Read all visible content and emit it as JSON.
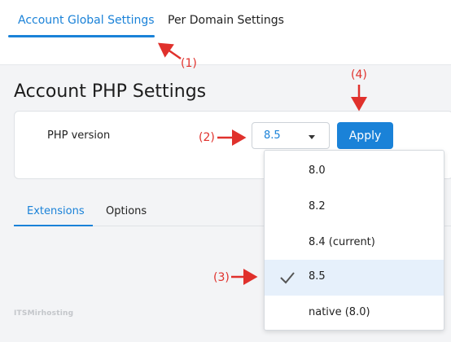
{
  "top_tabs": [
    {
      "label": "Account Global Settings",
      "active": true
    },
    {
      "label": "Per Domain Settings",
      "active": false
    }
  ],
  "page_title": "Account PHP Settings",
  "php_version": {
    "label": "PHP version",
    "selected": "8.5",
    "apply_label": "Apply"
  },
  "sub_tabs": [
    {
      "label": "Extensions",
      "active": true
    },
    {
      "label": "Options",
      "active": false
    }
  ],
  "dropdown": {
    "options": [
      {
        "label": "8.0",
        "selected": false
      },
      {
        "label": "8.2",
        "selected": false
      },
      {
        "label": "8.4 (current)",
        "selected": false
      },
      {
        "label": "8.5",
        "selected": true
      },
      {
        "label": "native (8.0)",
        "selected": false
      }
    ]
  },
  "annotations": [
    "(1)",
    "(2)",
    "(3)",
    "(4)"
  ],
  "watermark": "ITSMirhosting",
  "colors": {
    "accent": "#1a82d8",
    "annotation": "#e0312c",
    "selected_row": "#e6f0fb"
  }
}
